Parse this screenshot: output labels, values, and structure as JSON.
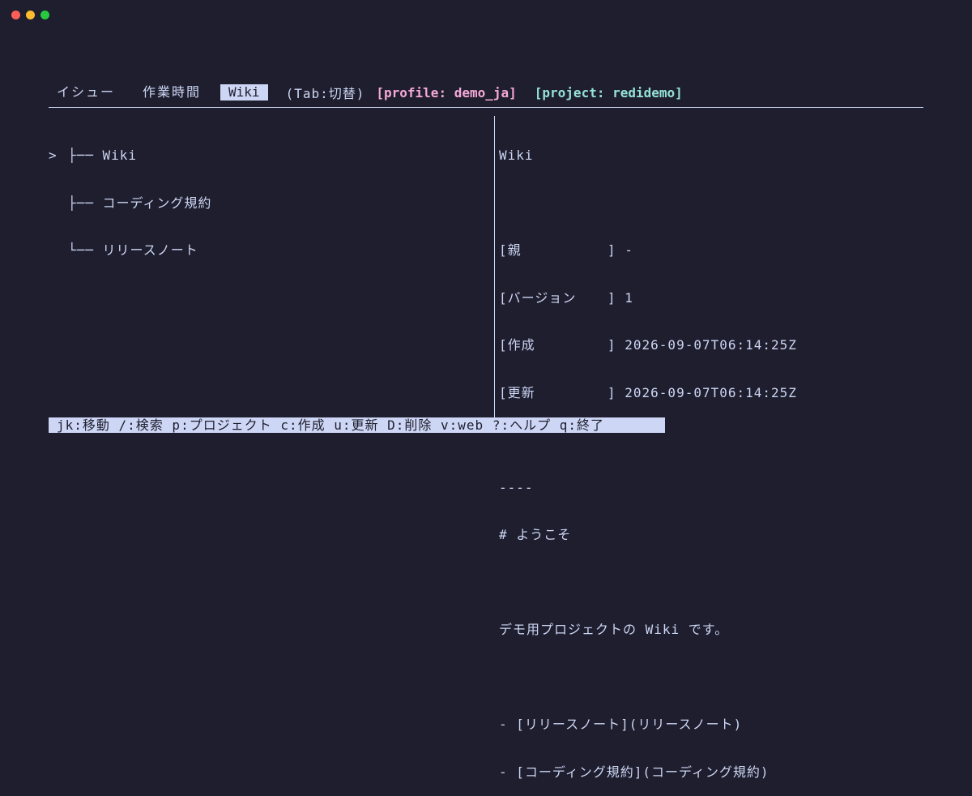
{
  "window": {
    "traffic_lights": [
      "#ff5f57",
      "#febc2e",
      "#28c840"
    ]
  },
  "tabs": [
    {
      "label": "イシュー",
      "active": false
    },
    {
      "label": "作業時間",
      "active": false
    },
    {
      "label": "Wiki",
      "active": true
    }
  ],
  "tab_hint": "(Tab:切替)",
  "profile_label": "[profile: demo_ja]",
  "project_label": "[project: redidemo]",
  "colors": {
    "background": "#1e1e2e",
    "text": "#cdd6f4",
    "profile": "#f5a9d8",
    "project": "#94e2d5"
  },
  "tree": {
    "cursor": ">",
    "items": [
      {
        "prefix": "├── ",
        "label": "Wiki",
        "selected": true
      },
      {
        "prefix": "├── ",
        "label": "コーディング規約",
        "selected": false
      },
      {
        "prefix": "└── ",
        "label": "リリースノート",
        "selected": false
      }
    ]
  },
  "detail": {
    "title": "Wiki",
    "meta": [
      {
        "key": "[親",
        "value": "] -"
      },
      {
        "key": "[バージョン",
        "value": "] 1"
      },
      {
        "key": "[作成",
        "value": "] 2026-09-07T06:14:25Z"
      },
      {
        "key": "[更新",
        "value": "] 2026-09-07T06:14:25Z"
      }
    ],
    "separator": "----",
    "heading": "# ようこそ",
    "body": "デモ用プロジェクトの Wiki です。",
    "links": [
      "- [リリースノート](リリースノート)",
      "- [コーディング規約](コーディング規約)"
    ]
  },
  "status_bar": "jk:移動 /:検索 p:プロジェクト c:作成 u:更新 D:削除 v:web ?:ヘルプ q:終了"
}
